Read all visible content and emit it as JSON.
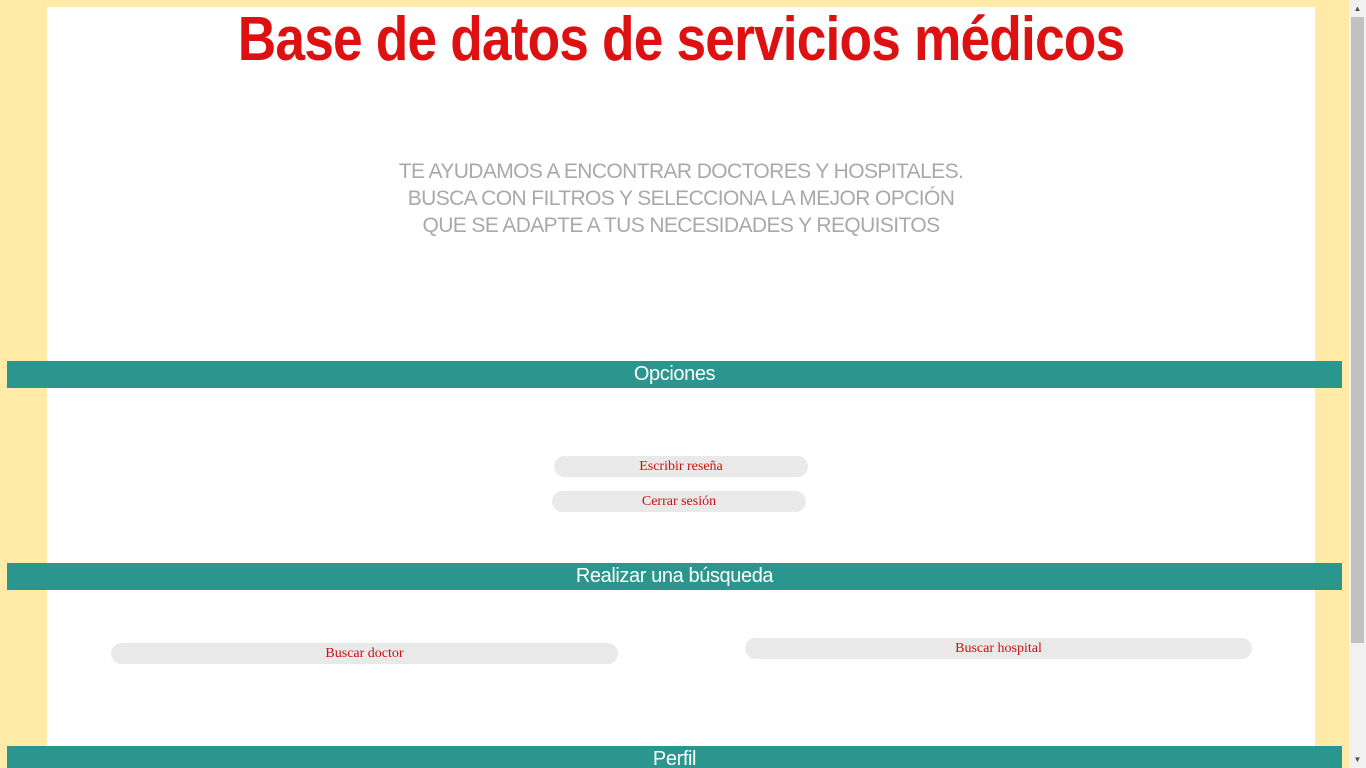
{
  "header": {
    "title": "Base de datos de servicios médicos",
    "tagline": [
      "TE AYUDAMOS A ENCONTRAR DOCTORES Y HOSPITALES.",
      "BUSCA CON FILTROS Y SELECCIONA LA MEJOR OPCIÓN",
      "QUE SE ADAPTE A TUS NECESIDADES Y REQUISITOS"
    ]
  },
  "sections": {
    "options": {
      "heading": "Opciones",
      "write_review": "Escribir reseña",
      "logout": "Cerrar sesión"
    },
    "search": {
      "heading": "Realizar una búsqueda",
      "search_doctor": "Buscar doctor",
      "search_hospital": "Buscar hospital"
    },
    "profile": {
      "heading": "Perfil"
    }
  },
  "scrollbar": {
    "up_icon": "triangle-up-icon",
    "down_icon": "triangle-down-icon"
  },
  "colors": {
    "page_background": "#ffeaa8",
    "title": "#dd1111",
    "band": "#2a968d",
    "tagline": "#a9a9a9",
    "button_text": "#cc1111",
    "button_background": "#e9e9e9"
  }
}
